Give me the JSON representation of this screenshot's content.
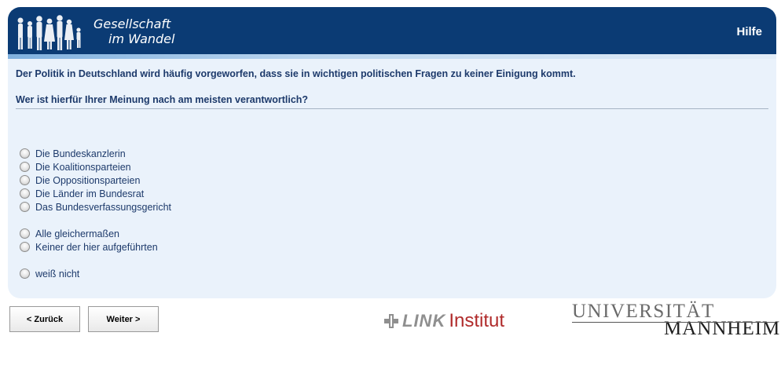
{
  "header": {
    "logo_line1": "Gesellschaft",
    "logo_line2": "im Wandel",
    "help_label": "Hilfe"
  },
  "intro_text": "Der Politik in Deutschland wird häufig vorgeworfen, dass sie in wichtigen politischen Fragen zu keiner Einigung kommt.",
  "question_text": "Wer ist hierfür Ihrer Meinung nach am meisten verantwortlich?",
  "options": [
    "Die Bundeskanzlerin",
    "Die Koalitionsparteien",
    "Die Oppositionsparteien",
    "Die Länder im Bundesrat",
    "Das Bundesverfassungsgericht",
    "Alle gleichermaßen",
    "Keiner der hier aufgeführten",
    "weiß nicht"
  ],
  "nav": {
    "back_label": "< Zurück",
    "next_label": "Weiter >"
  },
  "footer": {
    "link_word": "LINK",
    "link_institut": "Institut",
    "uni_line1": "UNIVERSITÄT",
    "uni_line2": "MANNHEIM"
  },
  "colors": {
    "header_bg": "#0b3b74",
    "panel_bg": "#eaf2fb",
    "text": "#1d3a6b",
    "link_red": "#b02b2b"
  }
}
